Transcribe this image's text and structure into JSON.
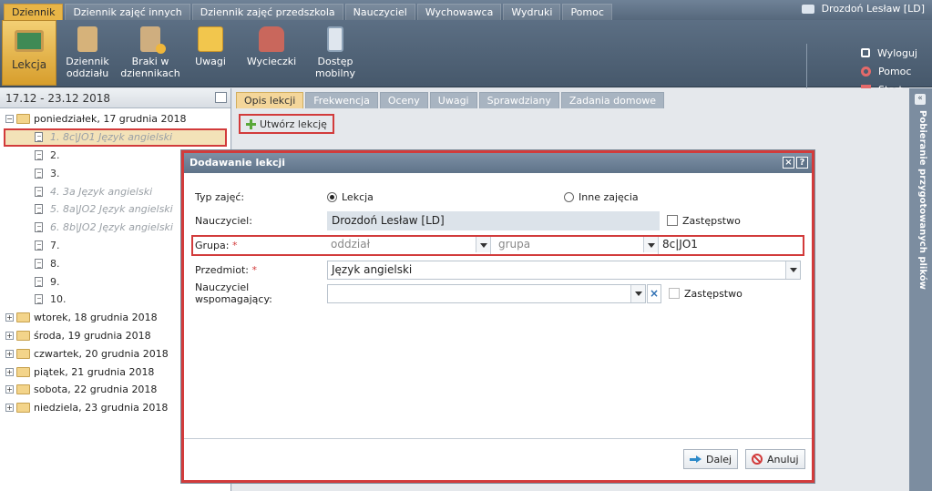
{
  "topmenu": {
    "items": [
      "Dziennik",
      "Dziennik zajęć innych",
      "Dziennik zajęć przedszkola",
      "Nauczyciel",
      "Wychowawca",
      "Wydruki",
      "Pomoc"
    ],
    "user": "Drozdoń Lesław [LD]"
  },
  "ribbon": {
    "buttons": [
      {
        "label": "Lekcja",
        "icon": "blackboard-icon"
      },
      {
        "label": "Dziennik oddziału",
        "icon": "book-icon"
      },
      {
        "label": "Braki w dziennikach",
        "icon": "book-warning-icon"
      },
      {
        "label": "Uwagi",
        "icon": "note-warning-icon"
      },
      {
        "label": "Wycieczki",
        "icon": "backpack-icon"
      },
      {
        "label": "Dostęp mobilny",
        "icon": "mobile-icon"
      }
    ],
    "links": [
      {
        "label": "Wyloguj",
        "icon": "lock-icon"
      },
      {
        "label": "Pomoc",
        "icon": "lifebuoy-icon"
      },
      {
        "label": "Start",
        "icon": "home-icon"
      }
    ]
  },
  "leftpanel": {
    "range": "17.12 - 23.12 2018",
    "open_day": "poniedziałek, 17 grudnia 2018",
    "lessons": [
      "1. 8c|JO1 Język angielski",
      "2.",
      "3.",
      "4. 3a Język angielski",
      "5. 8a|JO2 Język angielski",
      "6. 8b|JO2 Język angielski",
      "7.",
      "8.",
      "9.",
      "10."
    ],
    "days": [
      "wtorek, 18 grudnia 2018",
      "środa, 19 grudnia 2018",
      "czwartek, 20 grudnia 2018",
      "piątek, 21 grudnia 2018",
      "sobota, 22 grudnia 2018",
      "niedziela, 23 grudnia 2018"
    ]
  },
  "tabs": [
    "Opis lekcji",
    "Frekwencja",
    "Oceny",
    "Uwagi",
    "Sprawdziany",
    "Zadania domowe"
  ],
  "create_button": "Utwórz lekcję",
  "side_strip": "Pobieranie przygotowanych plików",
  "dialog": {
    "title": "Dodawanie lekcji",
    "typ_label": "Typ zajęć:",
    "typ_option1": "Lekcja",
    "typ_option2": "Inne zajęcia",
    "nauczyciel_label": "Nauczyciel:",
    "nauczyciel_value": "Drozdoń Lesław [LD]",
    "zastepstwo": "Zastępstwo",
    "grupa_label": "Grupa:",
    "oddzial_placeholder": "oddział",
    "grupa_placeholder": "grupa",
    "grupa_value": "8c|JO1",
    "przedmiot_label": "Przedmiot:",
    "przedmiot_value": "Język angielski",
    "wspomagajacy_label": "Nauczyciel wspomagający:",
    "wspomagajacy_value": "",
    "req": "*",
    "next_button": "Dalej",
    "cancel_button": "Anuluj",
    "close_glyph": "×",
    "help_glyph": "?",
    "clear_glyph": "×"
  }
}
